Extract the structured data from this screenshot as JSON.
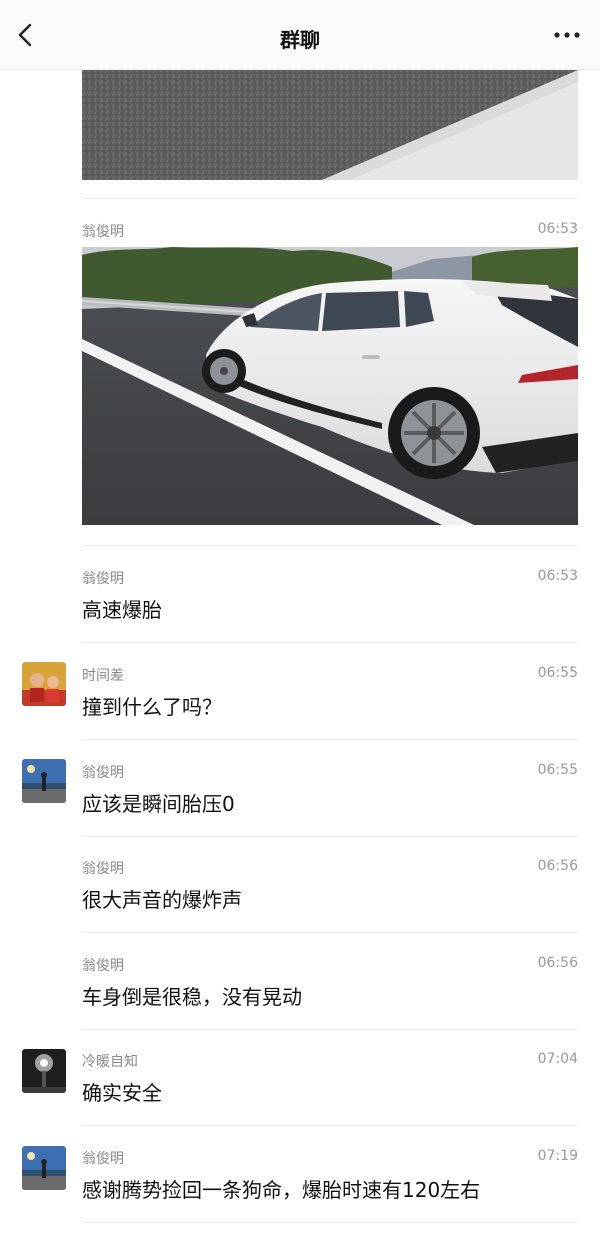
{
  "header": {
    "title": "群聊"
  },
  "photo_message": {
    "sender": "翁俊明",
    "time": "06:53"
  },
  "messages": [
    {
      "sender": "翁俊明",
      "time": "06:53",
      "text": "高速爆胎"
    },
    {
      "sender": "时间差",
      "time": "06:55",
      "text": "撞到什么了吗？"
    },
    {
      "sender": "翁俊明",
      "time": "06:55",
      "text": "应该是瞬间胎压0"
    },
    {
      "sender": "翁俊明",
      "time": "06:56",
      "text": "很大声音的爆炸声"
    },
    {
      "sender": "翁俊明",
      "time": "06:56",
      "text": "车身倒是很稳，没有晃动"
    },
    {
      "sender": "冷暖自知",
      "time": "07:04",
      "text": "确实安全"
    },
    {
      "sender": "翁俊明",
      "time": "07:19",
      "text": "感谢腾势捡回一条狗命，爆胎时速有120左右"
    }
  ],
  "icons": {
    "back": "chevron-left-icon",
    "more": "more-dots-icon"
  }
}
